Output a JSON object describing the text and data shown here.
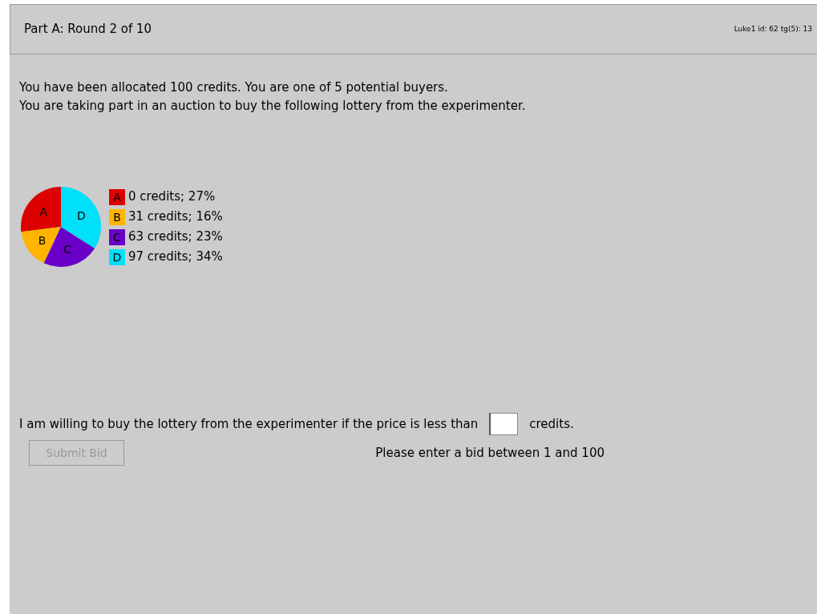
{
  "header": {
    "title": "Part A: Round 2 of 10",
    "info": "Luke1 id: 62 tg(5): 13"
  },
  "intro": [
    "You have been allocated 100 credits. You are one of 5 potential buyers.",
    "You are taking part in an auction to buy the following lottery from the experimenter."
  ],
  "lottery": {
    "chart_data": {
      "type": "pie",
      "categories": [
        "A",
        "B",
        "C",
        "D"
      ],
      "series": [
        {
          "values": [
            27,
            16,
            23,
            34
          ]
        }
      ]
    },
    "legend": [
      {
        "letter": "A",
        "text": "0 credits; 27%",
        "color": "#dd0000"
      },
      {
        "letter": "B",
        "text": "31 credits; 16%",
        "color": "#ffb400"
      },
      {
        "letter": "C",
        "text": "63 credits; 23%",
        "color": "#6a00c8"
      },
      {
        "letter": "D",
        "text": "97 credits; 34%",
        "color": "#00e0f8"
      }
    ]
  },
  "bid": {
    "prefix": "I am willing to buy the lottery from the experimenter if the price is less than",
    "suffix": "credits.",
    "submit": {
      "label": "Submit Bid",
      "disabled": true
    },
    "message": "Please enter a bid between 1 and 100"
  }
}
